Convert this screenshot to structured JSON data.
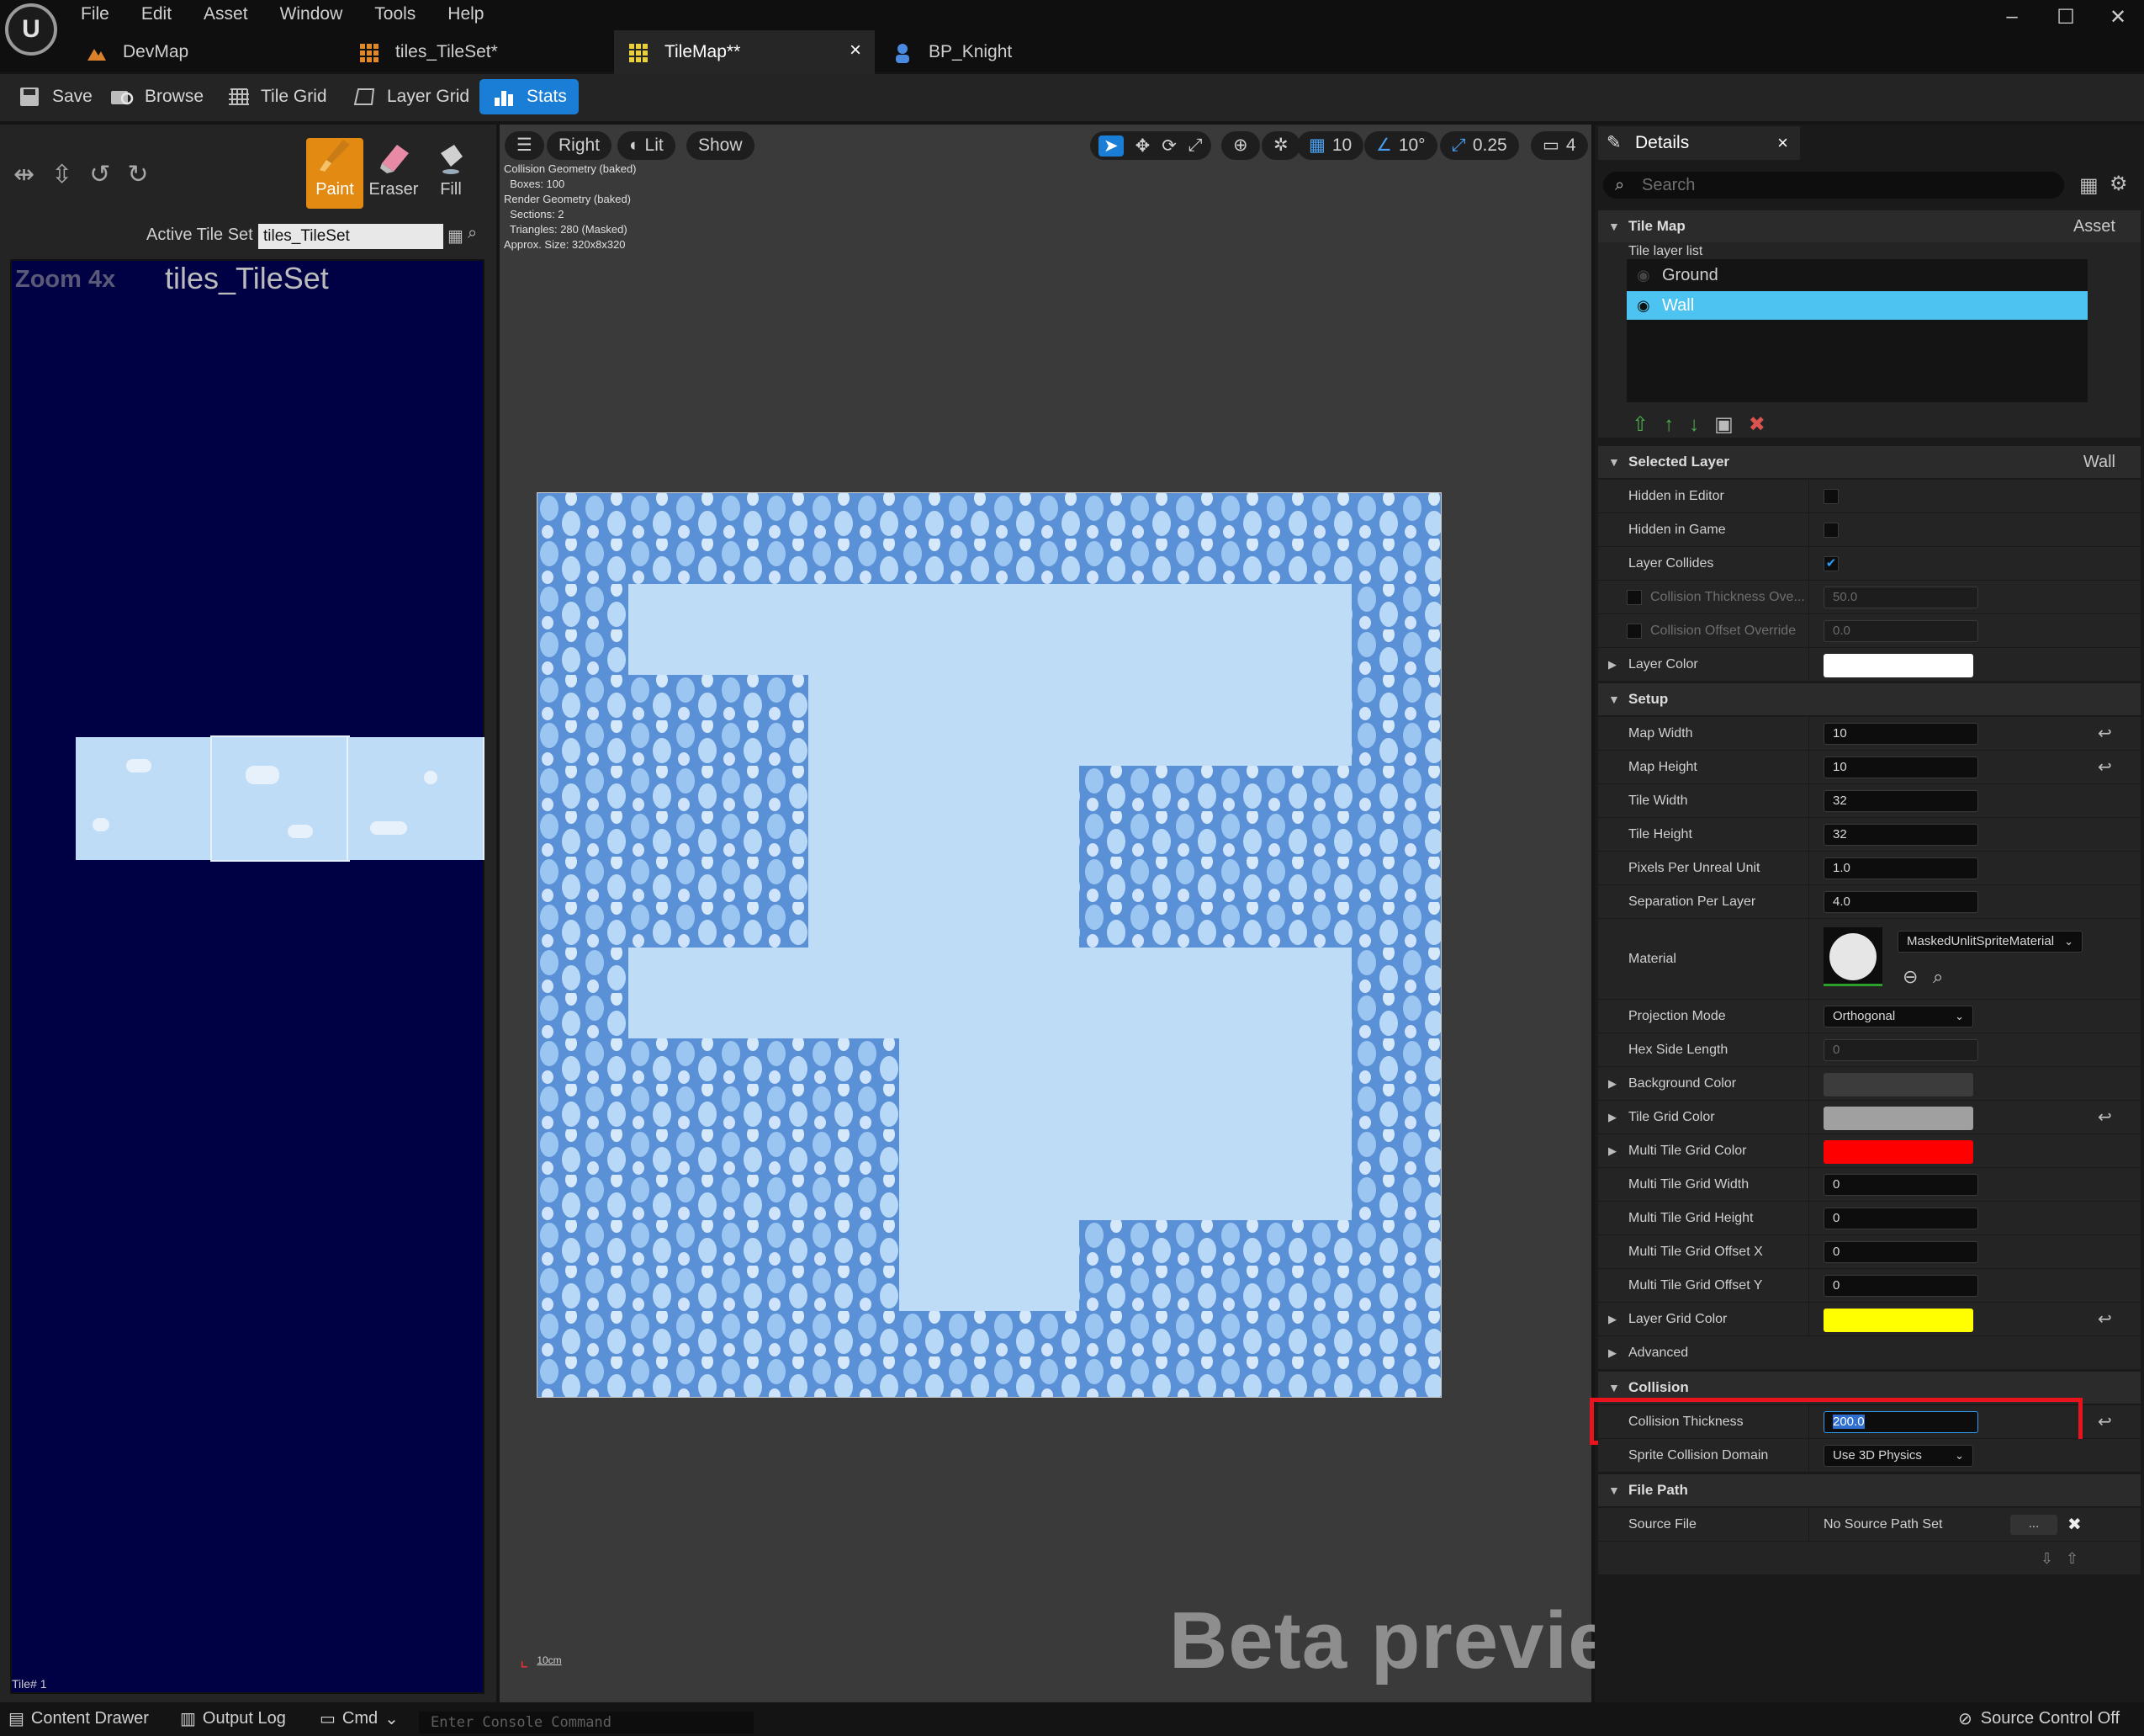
{
  "menu": [
    "File",
    "Edit",
    "Asset",
    "Window",
    "Tools",
    "Help"
  ],
  "tabs": [
    {
      "label": "DevMap",
      "icon": "level-icon"
    },
    {
      "label": "tiles_TileSet*",
      "icon": "tileset-icon"
    },
    {
      "label": "TileMap**",
      "icon": "tilemap-icon",
      "active": true,
      "close": "×"
    },
    {
      "label": "BP_Knight",
      "icon": "blueprint-icon"
    }
  ],
  "window_buttons": [
    "–",
    "☐",
    "✕"
  ],
  "toolbar": {
    "save": "Save",
    "browse": "Browse",
    "tile_grid": "Tile Grid",
    "layer_grid": "Layer Grid",
    "stats": "Stats"
  },
  "tools": {
    "paint": "Paint",
    "eraser": "Eraser",
    "fill": "Fill"
  },
  "left": {
    "active_tileset_label": "Active Tile Set",
    "active_tileset_value": "tiles_TileSet",
    "zoom": "Zoom 4x",
    "tileset_name": "tiles_TileSet",
    "tile_number": "Tile# 1"
  },
  "viewport": {
    "view_mode": "Right",
    "lit": "Lit",
    "show": "Show",
    "grid_snap": "10",
    "rot_snap": "10°",
    "scale_snap": "0.25",
    "cam_speed": "4",
    "stats_lines": [
      "Collision Geometry (baked)",
      "  Boxes: 100",
      "Render Geometry (baked)",
      "  Sections: 2",
      "  Triangles: 280 (Masked)",
      "Approx. Size: 320x8x320"
    ],
    "scale_label": "10cm",
    "beta": "Beta preview"
  },
  "details": {
    "tab": "Details",
    "search_placeholder": "Search",
    "tile_map_header": "Tile Map",
    "tile_map_right": "Asset",
    "tile_layer_list": "Tile layer list",
    "layers": [
      "Ground",
      "Wall"
    ],
    "selected_layer_header": "Selected Layer",
    "selected_layer_right": "Wall",
    "hidden_in_editor": "Hidden in Editor",
    "hidden_in_game": "Hidden in Game",
    "layer_collides": "Layer Collides",
    "collision_thickness_override": "Collision Thickness Ove...",
    "collision_thickness_override_val": "50.0",
    "collision_offset_override": "Collision Offset Override",
    "collision_offset_override_val": "0.0",
    "layer_color": "Layer Color",
    "setup_header": "Setup",
    "map_width": "Map Width",
    "map_width_val": "10",
    "map_height": "Map Height",
    "map_height_val": "10",
    "tile_width": "Tile Width",
    "tile_width_val": "32",
    "tile_height": "Tile Height",
    "tile_height_val": "32",
    "pixels_per_unit": "Pixels Per Unreal Unit",
    "pixels_per_unit_val": "1.0",
    "separation": "Separation Per Layer",
    "separation_val": "4.0",
    "material": "Material",
    "material_val": "MaskedUnlitSpriteMaterial",
    "projection_mode": "Projection Mode",
    "projection_mode_val": "Orthogonal",
    "hex_side": "Hex Side Length",
    "hex_side_val": "0",
    "background_color": "Background Color",
    "tile_grid_color": "Tile Grid Color",
    "multi_tile_grid_color": "Multi Tile Grid Color",
    "multi_tile_grid_width": "Multi Tile Grid Width",
    "multi_tile_grid_width_val": "0",
    "multi_tile_grid_height": "Multi Tile Grid Height",
    "multi_tile_grid_height_val": "0",
    "multi_tile_grid_offset_x": "Multi Tile Grid Offset X",
    "multi_tile_grid_offset_x_val": "0",
    "multi_tile_grid_offset_y": "Multi Tile Grid Offset Y",
    "multi_tile_grid_offset_y_val": "0",
    "layer_grid_color": "Layer Grid Color",
    "advanced": "Advanced",
    "collision_header": "Collision",
    "collision_thickness": "Collision Thickness",
    "collision_thickness_val": "200.0",
    "sprite_collision_domain": "Sprite Collision Domain",
    "sprite_collision_domain_val": "Use 3D Physics",
    "file_path_header": "File Path",
    "source_file": "Source File",
    "source_file_val": "No Source Path Set",
    "browse_dots": "..."
  },
  "colors": {
    "layer_color": "#ffffff",
    "background_color": "#3c3c3c",
    "tile_grid_color": "#a0a0a0",
    "multi_tile_grid_color": "#ff0000",
    "layer_grid_color": "#ffff00",
    "accent": "#1a7ed6",
    "highlight": "#e8131c"
  },
  "status": {
    "content_drawer": "Content Drawer",
    "output_log": "Output Log",
    "cmd": "Cmd",
    "console_placeholder": "Enter Console Command",
    "source_control": "Source Control Off"
  }
}
